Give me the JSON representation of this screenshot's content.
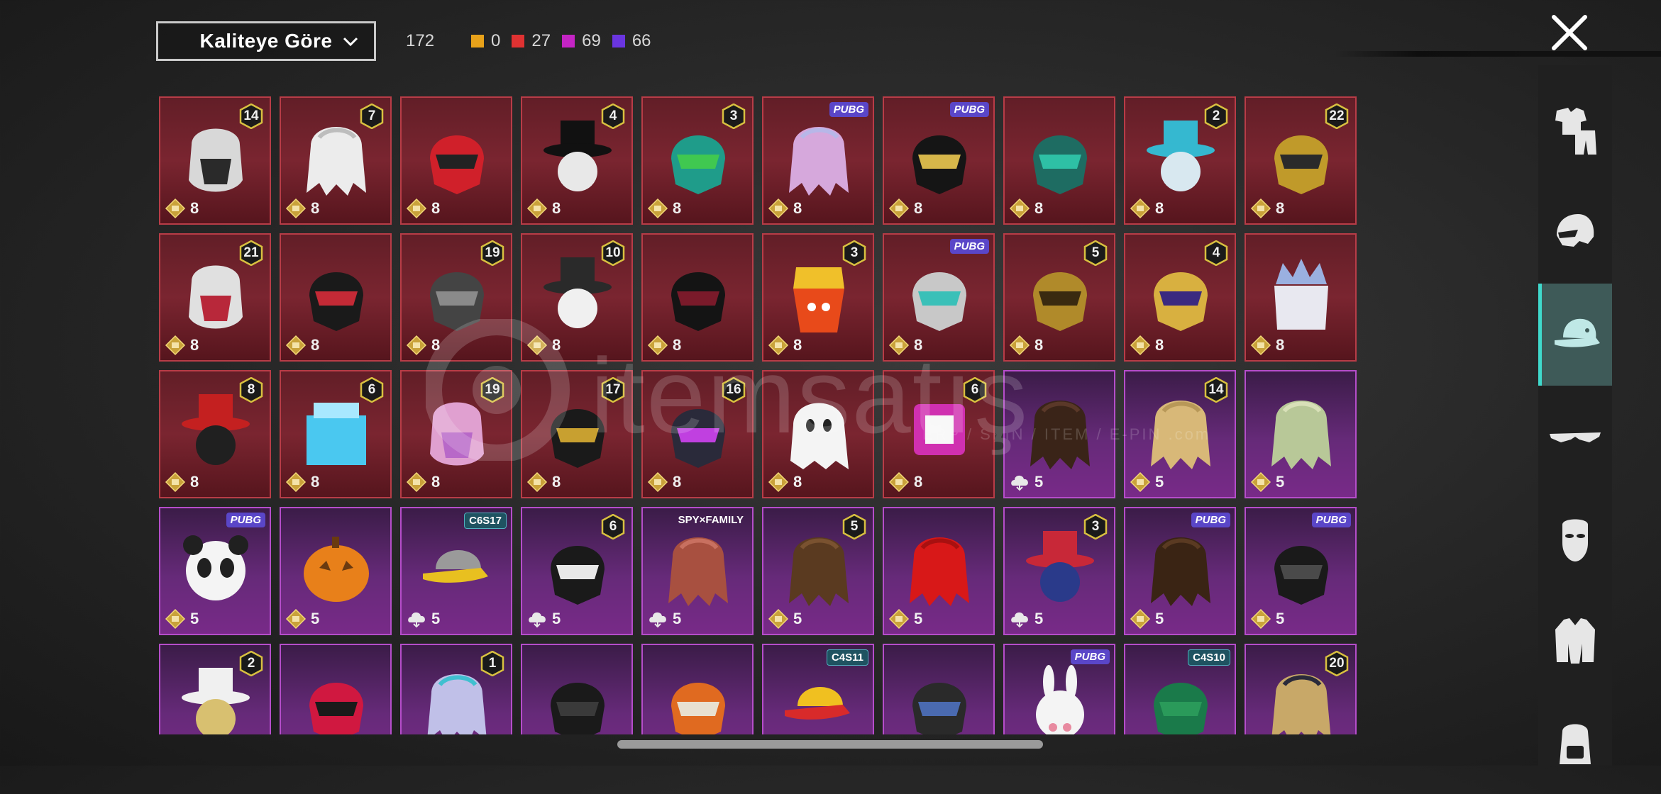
{
  "header": {
    "sort_label": "Kaliteye Göre",
    "total_count": "172",
    "rarity_counts": [
      {
        "label": "0",
        "color": "#e8a21a"
      },
      {
        "label": "27",
        "color": "#e03232"
      },
      {
        "label": "69",
        "color": "#c424c4"
      },
      {
        "label": "66",
        "color": "#6a35e0"
      }
    ],
    "close_icon": "close-icon"
  },
  "sidebar": {
    "items": [
      {
        "icon": "outfit-icon"
      },
      {
        "icon": "helmet-icon"
      },
      {
        "icon": "cap-icon",
        "active": true
      },
      {
        "icon": "glasses-icon"
      },
      {
        "icon": "mask-icon"
      },
      {
        "icon": "jacket-icon"
      },
      {
        "icon": "backpack-icon"
      }
    ]
  },
  "watermark": {
    "text": "itemsatış",
    "sub": "ERP / SKIN / ITEM / E-PIN  .com"
  },
  "items": [
    {
      "rarity": "red",
      "cost": "8",
      "badge": "14",
      "art": "hood",
      "c": "#d8d8d8",
      "c2": "#2a2a2a"
    },
    {
      "rarity": "red",
      "cost": "8",
      "badge": "7",
      "art": "hair",
      "c": "#ececec",
      "c2": "#bdbdbd"
    },
    {
      "rarity": "red",
      "cost": "8",
      "badge": "",
      "art": "helmet",
      "c": "#d0202a",
      "c2": "#222"
    },
    {
      "rarity": "red",
      "cost": "8",
      "badge": "4",
      "art": "hat",
      "c": "#111",
      "c2": "#e8e8e8"
    },
    {
      "rarity": "red",
      "cost": "8",
      "badge": "3",
      "art": "helmet",
      "c": "#1f9c8a",
      "c2": "#40c850"
    },
    {
      "rarity": "red",
      "cost": "8",
      "badge": "PUBG",
      "art": "hair",
      "c": "#d6a8dc",
      "c2": "#b7b7e8"
    },
    {
      "rarity": "red",
      "cost": "8",
      "badge": "PUBG",
      "art": "helmet",
      "c": "#151515",
      "c2": "#d6b64a"
    },
    {
      "rarity": "red",
      "cost": "8",
      "badge": "",
      "art": "helmet",
      "c": "#1e6c62",
      "c2": "#2ec0a5"
    },
    {
      "rarity": "red",
      "cost": "8",
      "badge": "2",
      "art": "hat",
      "c": "#35b8d0",
      "c2": "#d8e8f0"
    },
    {
      "rarity": "red",
      "cost": "8",
      "badge": "22",
      "art": "helmet",
      "c": "#c09a2a",
      "c2": "#2a2a2a"
    },
    {
      "rarity": "red",
      "cost": "8",
      "badge": "21",
      "art": "hood",
      "c": "#e0e0e0",
      "c2": "#b8283a"
    },
    {
      "rarity": "red",
      "cost": "8",
      "badge": "",
      "art": "helmet",
      "c": "#1a1a1a",
      "c2": "#c42a36"
    },
    {
      "rarity": "red",
      "cost": "8",
      "badge": "19",
      "art": "helmet",
      "c": "#444",
      "c2": "#8a8a8a"
    },
    {
      "rarity": "red",
      "cost": "8",
      "badge": "10",
      "art": "hat",
      "c": "#2a2a2a",
      "c2": "#f0f0f0"
    },
    {
      "rarity": "red",
      "cost": "8",
      "badge": "",
      "art": "helmet",
      "c": "#141414",
      "c2": "#7a1a2a"
    },
    {
      "rarity": "red",
      "cost": "8",
      "badge": "3",
      "art": "fries",
      "c": "#e84a1a",
      "c2": "#f0c02a"
    },
    {
      "rarity": "red",
      "cost": "8",
      "badge": "PUBG",
      "art": "helmet",
      "c": "#c8c8c8",
      "c2": "#3ac0b8"
    },
    {
      "rarity": "red",
      "cost": "8",
      "badge": "5",
      "art": "helmet",
      "c": "#b08a2a",
      "c2": "#3a2a10"
    },
    {
      "rarity": "red",
      "cost": "8",
      "badge": "4",
      "art": "helmet",
      "c": "#d8b040",
      "c2": "#3a2a80"
    },
    {
      "rarity": "red",
      "cost": "8",
      "badge": "",
      "art": "crown",
      "c": "#9ab0e0",
      "c2": "#e8e8f0"
    },
    {
      "rarity": "red",
      "cost": "8",
      "badge": "8",
      "art": "hat",
      "c": "#c42020",
      "c2": "#202020"
    },
    {
      "rarity": "red",
      "cost": "8",
      "badge": "6",
      "art": "ice",
      "c": "#4ac8f0",
      "c2": "#a8e8ff"
    },
    {
      "rarity": "red",
      "cost": "8",
      "badge": "19",
      "art": "hood",
      "c": "#e0a0d0",
      "c2": "#b868c8"
    },
    {
      "rarity": "red",
      "cost": "8",
      "badge": "17",
      "art": "helmet",
      "c": "#1a1a1a",
      "c2": "#c8a030"
    },
    {
      "rarity": "red",
      "cost": "8",
      "badge": "16",
      "art": "helmet",
      "c": "#2a2a3a",
      "c2": "#c040e0"
    },
    {
      "rarity": "red",
      "cost": "8",
      "badge": "",
      "art": "ghost",
      "c": "#f4f4f4",
      "c2": "#222"
    },
    {
      "rarity": "red",
      "cost": "8",
      "badge": "6",
      "art": "box",
      "c": "#d030b0",
      "c2": "#f8f8f8"
    },
    {
      "rarity": "purple",
      "cost": "5",
      "badge": "",
      "art": "hair",
      "c": "#3a2418",
      "c2": "#5a3828",
      "cloud": true
    },
    {
      "rarity": "purple",
      "cost": "5",
      "badge": "14",
      "art": "hair",
      "c": "#d8b878",
      "c2": "#b89858"
    },
    {
      "rarity": "purple",
      "cost": "5",
      "badge": "",
      "art": "hair",
      "c": "#b8c898",
      "c2": "#d8e0b8"
    },
    {
      "rarity": "purple",
      "cost": "5",
      "badge": "PUBG",
      "art": "panda",
      "c": "#f4f4f4",
      "c2": "#202020"
    },
    {
      "rarity": "purple",
      "cost": "5",
      "badge": "",
      "art": "pumpkin",
      "c": "#e8801a",
      "c2": "#6a3a10"
    },
    {
      "rarity": "purple",
      "cost": "5",
      "badge": "C6S17",
      "art": "cap",
      "c": "#e8c020",
      "c2": "#9a9a9a",
      "cloud": true
    },
    {
      "rarity": "purple",
      "cost": "5",
      "badge": "6",
      "art": "helmet",
      "c": "#1a1a1a",
      "c2": "#e8e8e8",
      "cloud": true
    },
    {
      "rarity": "purple",
      "cost": "5",
      "badge": "SPY×FAMILY",
      "art": "hair",
      "c": "#a85040",
      "c2": "#c87060",
      "cloud": true
    },
    {
      "rarity": "purple",
      "cost": "5",
      "badge": "5",
      "art": "hair",
      "c": "#5a3a20",
      "c2": "#7a5230"
    },
    {
      "rarity": "purple",
      "cost": "5",
      "badge": "",
      "art": "hair",
      "c": "#d81818",
      "c2": "#a81010"
    },
    {
      "rarity": "purple",
      "cost": "5",
      "badge": "3",
      "art": "hat",
      "c": "#c82838",
      "c2": "#2a3a8a",
      "cloud": true
    },
    {
      "rarity": "purple",
      "cost": "5",
      "badge": "PUBG",
      "art": "hair",
      "c": "#3a2414",
      "c2": "#5a3a22"
    },
    {
      "rarity": "purple",
      "cost": "5",
      "badge": "PUBG",
      "art": "helmet",
      "c": "#1a1a1a",
      "c2": "#4a4a4a"
    },
    {
      "rarity": "purple",
      "cost": "",
      "badge": "2",
      "art": "hat",
      "c": "#f0f0f0",
      "c2": "#d8c070"
    },
    {
      "rarity": "purple",
      "cost": "",
      "badge": "",
      "art": "helmet",
      "c": "#d01840",
      "c2": "#1a1a1a"
    },
    {
      "rarity": "purple",
      "cost": "",
      "badge": "1",
      "art": "hair",
      "c": "#c0c0e8",
      "c2": "#40c0d0"
    },
    {
      "rarity": "purple",
      "cost": "",
      "badge": "",
      "art": "helmet",
      "c": "#1a1a1a",
      "c2": "#3a3a3a"
    },
    {
      "rarity": "purple",
      "cost": "",
      "badge": "",
      "art": "helmet",
      "c": "#e06a20",
      "c2": "#e8e0d0"
    },
    {
      "rarity": "purple",
      "cost": "",
      "badge": "C4S11",
      "art": "cap",
      "c": "#d82a2a",
      "c2": "#f0c020"
    },
    {
      "rarity": "purple",
      "cost": "",
      "badge": "",
      "art": "helmet",
      "c": "#2a2a2a",
      "c2": "#4a6ab0"
    },
    {
      "rarity": "purple",
      "cost": "",
      "badge": "PUBG",
      "art": "bunny",
      "c": "#f4f4f4",
      "c2": "#e88aa0"
    },
    {
      "rarity": "purple",
      "cost": "",
      "badge": "C4S10",
      "art": "helmet",
      "c": "#1a7a4a",
      "c2": "#2a9a5a"
    },
    {
      "rarity": "purple",
      "cost": "",
      "badge": "20",
      "art": "hair",
      "c": "#c8a868",
      "c2": "#2a2a3a"
    }
  ]
}
